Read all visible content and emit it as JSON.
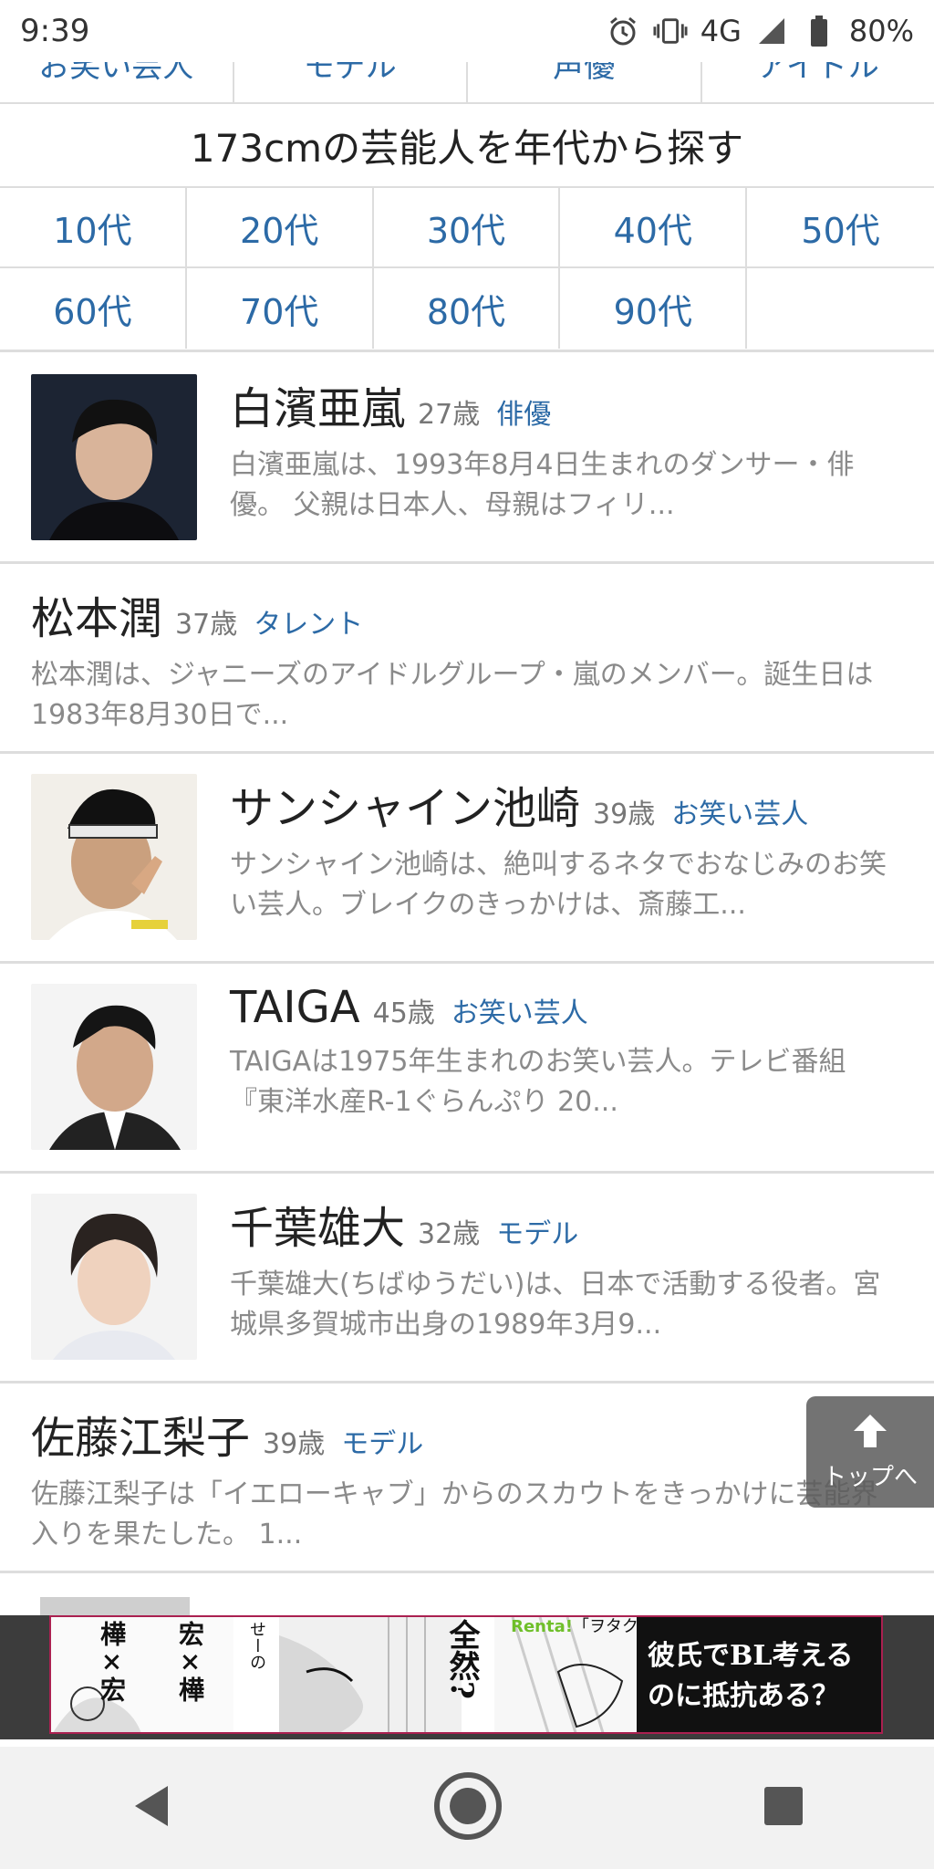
{
  "status_bar": {
    "time": "9:39",
    "network": "4G",
    "battery": "80%",
    "icons": [
      "alarm-icon",
      "vibrate-icon",
      "signal-icon",
      "battery-icon"
    ]
  },
  "top_categories": [
    "お笑い芸人",
    "モデル",
    "声優",
    "アイドル"
  ],
  "section_title": "173cmの芸能人を年代から探す",
  "age_filters": [
    "10代",
    "20代",
    "30代",
    "40代",
    "50代",
    "60代",
    "70代",
    "80代",
    "90代"
  ],
  "people": [
    {
      "name": "白濱亜嵐",
      "age": "27歳",
      "category": "俳優",
      "desc": "白濱亜嵐は、1993年8月4日生まれのダンサー・俳優。 父親は日本人、母親はフィリ...",
      "photo": true
    },
    {
      "name": "松本潤",
      "age": "37歳",
      "category": "タレント",
      "desc": "松本潤は、ジャニーズのアイドルグループ・嵐のメンバー。誕生日は1983年8月30日で...",
      "photo": false
    },
    {
      "name": "サンシャイン池崎",
      "age": "39歳",
      "category": "お笑い芸人",
      "desc": "サンシャイン池崎は、絶叫するネタでおなじみのお笑い芸人。ブレイクのきっかけは、斎藤工...",
      "photo": true
    },
    {
      "name": "TAIGA",
      "age": "45歳",
      "category": "お笑い芸人",
      "desc": "TAIGAは1975年生まれのお笑い芸人。テレビ番組『東洋水産R-1ぐらんぷり 20...",
      "photo": true
    },
    {
      "name": "千葉雄大",
      "age": "32歳",
      "category": "モデル",
      "desc": "千葉雄大(ちばゆうだい)は、日本で活動する役者。宮城県多賀城市出身の1989年3月9...",
      "photo": true
    },
    {
      "name": "佐藤江梨子",
      "age": "39歳",
      "category": "モデル",
      "desc": "佐藤江梨子は「イエローキャブ」からのスカウトをきっかけに芸能界入りを果たした。 1...",
      "photo": false
    }
  ],
  "top_button": {
    "label": "トップへ"
  },
  "ad": {
    "brand_prefix": "Renta!",
    "brand_rest": "「ヲタクに恋は難しい」©ふじた/一迅社",
    "v1": "樺×宏",
    "v2": "宏×樺",
    "v3": "せーの",
    "center": "全然?",
    "right_line1": "彼氏でBL考える",
    "right_line2": "のに抵抗ある？"
  },
  "nav": [
    "back-icon",
    "home-icon",
    "recents-icon"
  ]
}
